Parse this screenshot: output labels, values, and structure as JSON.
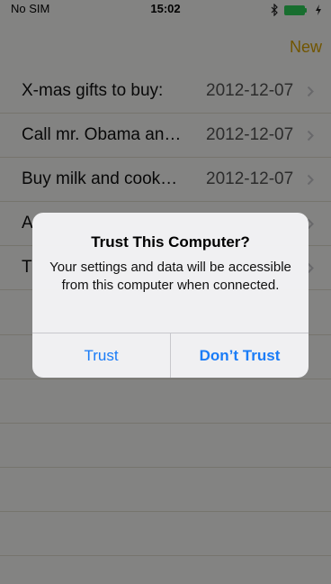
{
  "status_bar": {
    "carrier": "No SIM",
    "time": "15:02"
  },
  "nav": {
    "new_label": "New",
    "accent_color": "#d9a400"
  },
  "notes": [
    {
      "title": "X-mas gifts to buy:",
      "date": "2012-12-07"
    },
    {
      "title": "Call mr. Obama an…",
      "date": "2012-12-07"
    },
    {
      "title": "Buy milk and cook…",
      "date": "2012-12-07"
    },
    {
      "title": "A",
      "date": ""
    },
    {
      "title": "T",
      "date": ""
    }
  ],
  "alert": {
    "title": "Trust This Computer?",
    "message": "Your settings and data will be accessible from this computer when connected.",
    "trust_label": "Trust",
    "dont_trust_label": "Don’t Trust",
    "button_color": "#1a7cf7"
  }
}
